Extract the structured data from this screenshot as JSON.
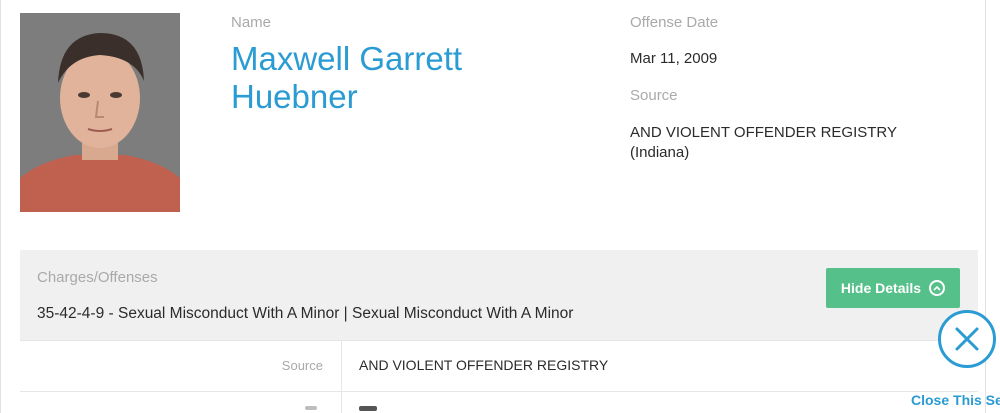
{
  "profile": {
    "name_label": "Name",
    "full_name": "Maxwell Garrett Huebner",
    "offense_date_label": "Offense Date",
    "offense_date": "Mar 11, 2009",
    "source_label": "Source",
    "source": "AND VIOLENT OFFENDER REGISTRY (Indiana)"
  },
  "charges": {
    "label": "Charges/Offenses",
    "value": "35-42-4-9 - Sexual Misconduct With A Minor | Sexual Misconduct With A Minor",
    "hide_button": "Hide Details"
  },
  "details": {
    "rows": [
      {
        "key": "Source",
        "value": "AND VIOLENT OFFENDER REGISTRY"
      }
    ]
  },
  "close_section": "Close This Se",
  "colors": {
    "accent": "#2a9bd3",
    "button_green": "#55c08a",
    "panel_bg": "#f0f0f0"
  }
}
